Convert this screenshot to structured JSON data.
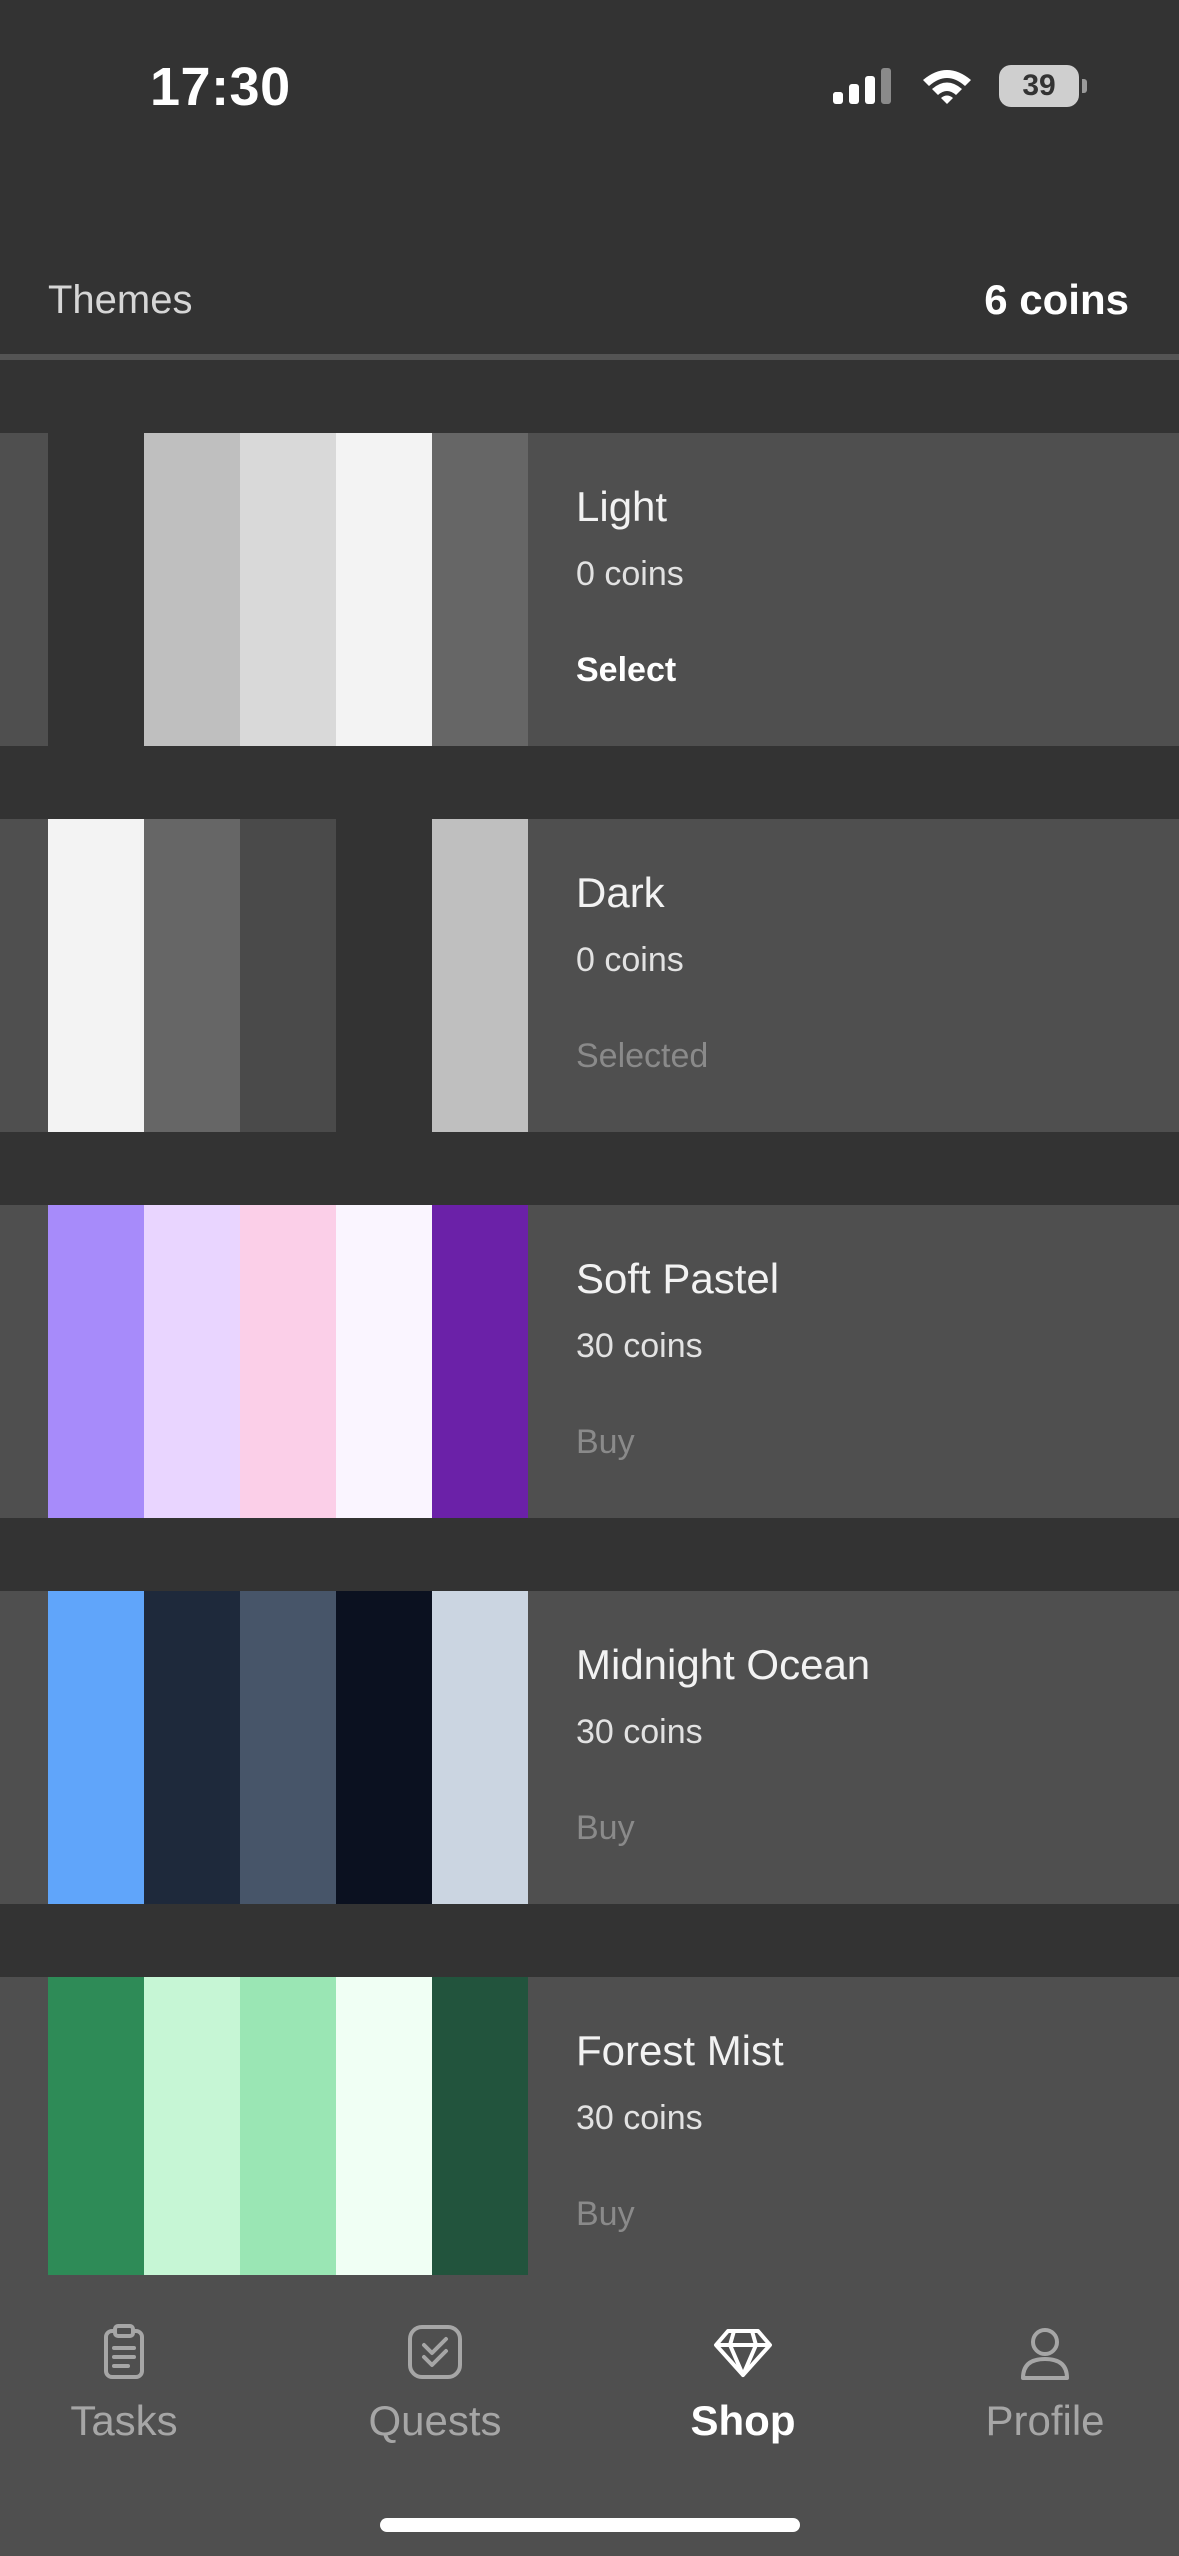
{
  "status_bar": {
    "time": "17:30",
    "battery": "39",
    "icons": [
      "cellular-signal-icon",
      "wifi-icon",
      "battery-icon"
    ]
  },
  "header": {
    "title": "Themes",
    "coins": "6 coins"
  },
  "themes": [
    {
      "name": "Light",
      "price": "0 coins",
      "action": "Select",
      "action_state": "select",
      "colors": [
        "#333333",
        "#bfbfbf",
        "#d9d9d9",
        "#f3f3f3",
        "#666666"
      ]
    },
    {
      "name": "Dark",
      "price": "0 coins",
      "action": "Selected",
      "action_state": "selected",
      "colors": [
        "#f3f3f3",
        "#666666",
        "#4a4a4a",
        "#333333",
        "#bfbfbf"
      ]
    },
    {
      "name": "Soft Pastel",
      "price": "30 coins",
      "action": "Buy",
      "action_state": "buy",
      "colors": [
        "#a78bfa",
        "#e9d5ff",
        "#fbcfe8",
        "#faf5ff",
        "#6b21a8"
      ]
    },
    {
      "name": "Midnight Ocean",
      "price": "30 coins",
      "action": "Buy",
      "action_state": "buy",
      "colors": [
        "#60a5fa",
        "#1e293b",
        "#475569",
        "#0b1120",
        "#cbd5e1"
      ]
    },
    {
      "name": "Forest Mist",
      "price": "30 coins",
      "action": "Buy",
      "action_state": "buy",
      "colors": [
        "#2e8b57",
        "#c6f6d5",
        "#9ae6b4",
        "#f0fff4",
        "#22543d"
      ]
    }
  ],
  "nav": {
    "items": [
      {
        "label": "Tasks",
        "icon": "clipboard-icon",
        "active": false
      },
      {
        "label": "Quests",
        "icon": "check-square-icon",
        "active": false
      },
      {
        "label": "Shop",
        "icon": "diamond-icon",
        "active": true
      },
      {
        "label": "Profile",
        "icon": "user-icon",
        "active": false
      }
    ]
  },
  "colors": {
    "background": "#333333",
    "card": "#4f4f4f",
    "muted_text": "#8a8a8a",
    "nav_inactive": "#a6a6a6",
    "nav_active": "#ffffff"
  }
}
